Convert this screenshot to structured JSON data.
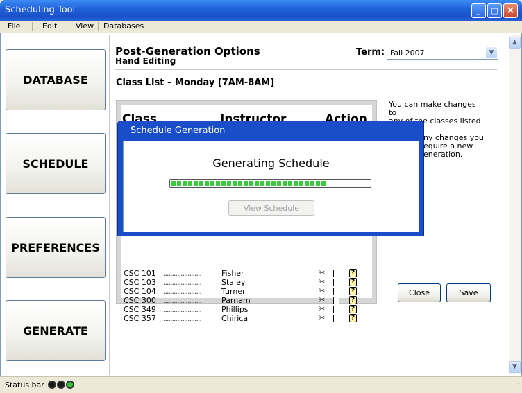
{
  "window": {
    "title": "Scheduling Tool",
    "minimize_icon": "minimize-icon",
    "maximize_icon": "maximize-icon",
    "close_icon": "close-icon"
  },
  "menu": [
    "File",
    "Edit",
    "View",
    "Databases"
  ],
  "sidebar": {
    "database": "DATABASE",
    "schedule": "SCHEDULE",
    "preferences": "PREFERENCES",
    "generate": "GENERATE"
  },
  "header": {
    "title": "Post-Generation Options",
    "subtitle": "Hand Editing",
    "term_label": "Term:",
    "term_value": "Fall 2007"
  },
  "class_list": {
    "title": "Class List – Monday [7AM-8AM]",
    "columns": {
      "class": "Class",
      "instructor": "Instructor",
      "action": "Action"
    },
    "rows": [
      {
        "code": "CSC 101",
        "dots": "......................",
        "instructor": "Fisher"
      },
      {
        "code": "CSC 103",
        "dots": "......................",
        "instructor": "Staley"
      },
      {
        "code": "CSC 104",
        "dots": "......................",
        "instructor": "Turner"
      },
      {
        "code": "CSC 300",
        "dots": "......................",
        "instructor": "Parnam"
      },
      {
        "code": "CSC 349",
        "dots": "......................",
        "instructor": "Phillips"
      },
      {
        "code": "CSC 357",
        "dots": "......................",
        "instructor": "Chirica"
      }
    ],
    "action_icons": [
      "scissors-icon",
      "document-icon",
      "help-icon"
    ],
    "help_glyph": "?"
  },
  "help_text": [
    "You can make changes to",
    "any of the classes listed to",
    "ny changes you",
    "equire a new",
    "eneration."
  ],
  "buttons": {
    "close": "Close",
    "save": "Save"
  },
  "dialog": {
    "title": "Schedule Generation",
    "message": "Generating Schedule",
    "progress_fraction": 0.78,
    "view_button": "View Schedule"
  },
  "status": {
    "text": "Status bar",
    "lights": [
      "#1A1A1A",
      "#1A1A1A",
      "#34C234"
    ]
  }
}
